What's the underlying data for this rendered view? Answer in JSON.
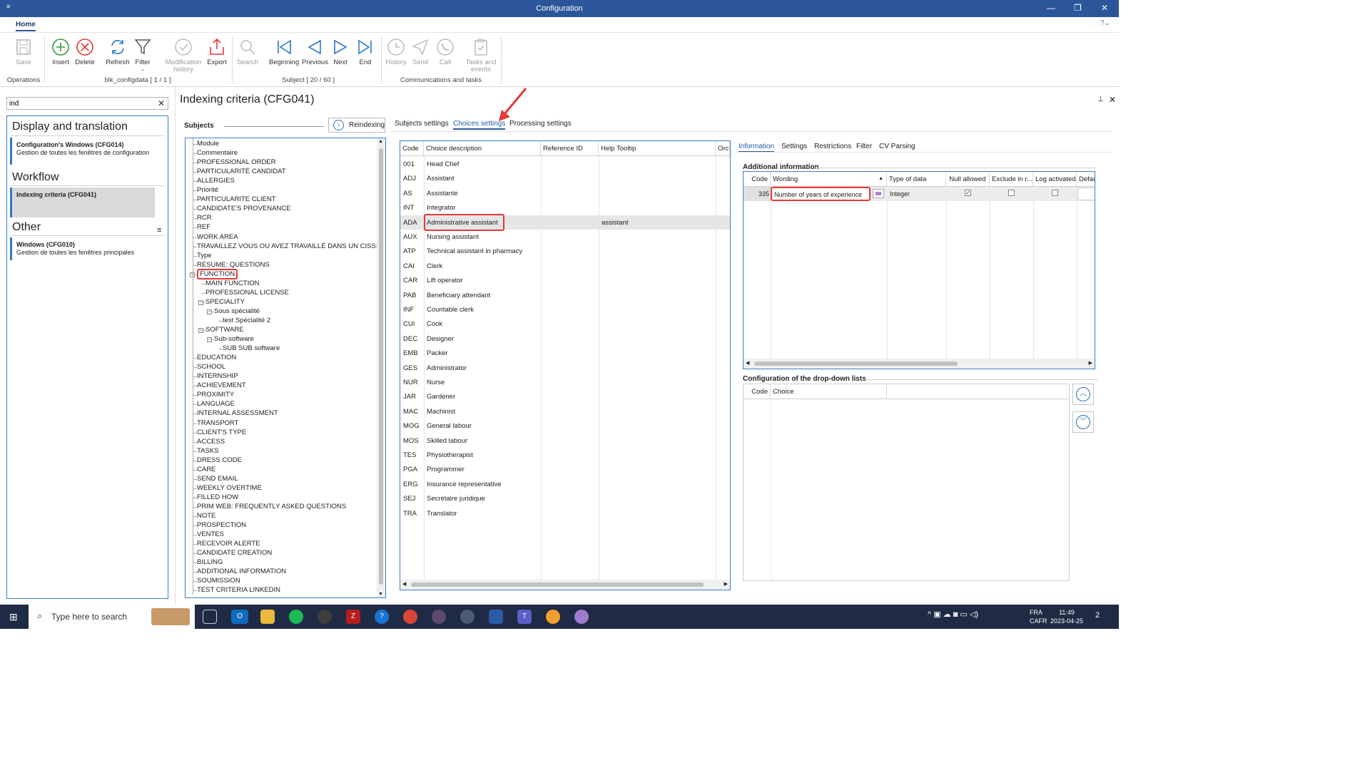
{
  "window": {
    "title": "Configuration",
    "menu_glyph": "≡",
    "minimize": "—",
    "restore": "❐",
    "close": "✕"
  },
  "ribbon": {
    "tab": "Home",
    "help": "?⌄",
    "buttons": {
      "save": "Save",
      "insert": "Insert",
      "delete": "Delete",
      "refresh": "Refresh",
      "filter": "Filter",
      "modification_history_1": "Modification",
      "modification_history_2": "history",
      "export": "Export",
      "search": "Search",
      "beginning": "Beginning",
      "previous": "Previous",
      "next": "Next",
      "end": "End",
      "history": "History",
      "send": "Send",
      "call": "Call",
      "tasks_events_1": "Tasks and",
      "tasks_events_2": "events"
    },
    "groups": {
      "operations": "Operations",
      "configdata": "blk_configdata [ 1 / 1 ]",
      "subject": "Subject [ 20 / 60 ]",
      "communications": "Communications and tasks"
    },
    "accent": "#2b579a"
  },
  "left": {
    "search_value": "ind",
    "clear": "✕",
    "menu_glyph": "≡",
    "sections": [
      {
        "title": "Display and translation",
        "items": [
          {
            "name": "Configuration's Windows (CFG014)",
            "desc": "Gestion de toutes les fenêtres de configuration"
          }
        ]
      },
      {
        "title": "Workflow",
        "items": [
          {
            "name": "Indexing criteria (CFG041)",
            "desc": ""
          }
        ]
      },
      {
        "title": "Other",
        "items": [
          {
            "name": "Windows (CFG010)",
            "desc": "Gestion de toutes les fenêtres principales"
          }
        ]
      }
    ]
  },
  "main": {
    "title": "Indexing criteria (CFG041)",
    "pin": "⊥",
    "close": "✕",
    "subjects_label": "Subjects",
    "reindex": "Reindexing",
    "reindex_glyph": "›",
    "tabs": [
      "Subjects settings",
      "Choices settings",
      "Processing settings"
    ],
    "active_tab": "Choices settings"
  },
  "tree": [
    {
      "label": "Module",
      "level": 0
    },
    {
      "label": "Commentaire",
      "level": 0
    },
    {
      "label": "PROFESSIONAL ORDER",
      "level": 0
    },
    {
      "label": "PARTICULARITÉ CANDIDAT",
      "level": 0
    },
    {
      "label": "ALLERGIES",
      "level": 0
    },
    {
      "label": "Priorité",
      "level": 0
    },
    {
      "label": "PARTICULARITE CLIENT",
      "level": 0
    },
    {
      "label": "CANDIDATE'S PROVENANCE",
      "level": 0
    },
    {
      "label": "RCR",
      "level": 0
    },
    {
      "label": "REF",
      "level": 0
    },
    {
      "label": "WORK AREA",
      "level": 0
    },
    {
      "label": "TRAVAILLEZ VOUS OU AVEZ TRAVAILLÉ DANS UN CISSS?",
      "level": 0
    },
    {
      "label": "Type",
      "level": 0
    },
    {
      "label": "RESUME: QUESTIONS",
      "level": 0
    },
    {
      "label": "FUNCTION",
      "level": 0,
      "expanded": true,
      "highlighted": true
    },
    {
      "label": "MAIN FUNCTION",
      "level": 1
    },
    {
      "label": "PROFESSIONAL LICENSE",
      "level": 1
    },
    {
      "label": "SPECIALITY",
      "level": 1,
      "expanded": true
    },
    {
      "label": "Sous spécialité",
      "level": 2,
      "expanded": true
    },
    {
      "label": "test Spécialité 2",
      "level": 3
    },
    {
      "label": "SOFTWARE",
      "level": 1,
      "expanded": true
    },
    {
      "label": "Sub-software",
      "level": 2,
      "expanded": true
    },
    {
      "label": "SUB SUB software",
      "level": 3
    },
    {
      "label": "EDUCATION",
      "level": 0
    },
    {
      "label": "SCHOOL",
      "level": 0
    },
    {
      "label": "INTERNSHIP",
      "level": 0
    },
    {
      "label": "ACHIEVEMENT",
      "level": 0
    },
    {
      "label": "PROXIMITY",
      "level": 0
    },
    {
      "label": "LANGUAGE",
      "level": 0
    },
    {
      "label": "INTERNAL ASSESSMENT",
      "level": 0
    },
    {
      "label": "TRANSPORT",
      "level": 0
    },
    {
      "label": "CLIENT'S TYPE",
      "level": 0
    },
    {
      "label": "ACCESS",
      "level": 0
    },
    {
      "label": "TASKS",
      "level": 0
    },
    {
      "label": "DRESS CODE",
      "level": 0
    },
    {
      "label": "CARE",
      "level": 0
    },
    {
      "label": "SEND EMAIL",
      "level": 0
    },
    {
      "label": "WEEKLY OVERTIME",
      "level": 0
    },
    {
      "label": "FILLED HOW",
      "level": 0
    },
    {
      "label": "PRIM WEB: FREQUENTLY ASKED QUESTIONS",
      "level": 0
    },
    {
      "label": "NOTE",
      "level": 0
    },
    {
      "label": "PROSPECTION",
      "level": 0
    },
    {
      "label": "VENTES",
      "level": 0
    },
    {
      "label": "RECEVOIR ALERTE",
      "level": 0
    },
    {
      "label": "CANDIDATE CREATION",
      "level": 0
    },
    {
      "label": "BILLING",
      "level": 0
    },
    {
      "label": "ADDITIONAL INFORMATION",
      "level": 0
    },
    {
      "label": "SOUMISSION",
      "level": 0
    },
    {
      "label": "TEST CRITERIA LINKEDIN",
      "level": 0
    }
  ],
  "choices": {
    "headers": [
      "Code",
      "Choice description",
      "Reference ID",
      "Help Tooltip",
      "Orc"
    ],
    "rows": [
      [
        "001",
        "Head Chef",
        "",
        ""
      ],
      [
        "ADJ",
        "Assistant",
        "",
        ""
      ],
      [
        "AS",
        "Assistante",
        "",
        ""
      ],
      [
        "INT",
        "Integrator",
        "",
        ""
      ],
      [
        "ADA",
        "Administrative assistant",
        "",
        "assistant"
      ],
      [
        "AUX",
        "Nursing assistant",
        "",
        ""
      ],
      [
        "ATP",
        "Technical assistant in pharmacy",
        "",
        ""
      ],
      [
        "CAI",
        "Clerk",
        "",
        ""
      ],
      [
        "CAR",
        "Lift operator",
        "",
        ""
      ],
      [
        "PAB",
        "Beneficiary attendant",
        "",
        ""
      ],
      [
        "INF",
        "Countable clerk",
        "",
        ""
      ],
      [
        "CUI",
        "Cook",
        "",
        ""
      ],
      [
        "DEC",
        "Designer",
        "",
        ""
      ],
      [
        "EMB",
        "Packer",
        "",
        ""
      ],
      [
        "GES",
        "Administrator",
        "",
        ""
      ],
      [
        "NUR",
        "Nurse",
        "",
        ""
      ],
      [
        "JAR",
        "Gardener",
        "",
        ""
      ],
      [
        "MAC",
        "Machinist",
        "",
        ""
      ],
      [
        "MOG",
        "General labour",
        "",
        ""
      ],
      [
        "MOS",
        "Skilled labour",
        "",
        ""
      ],
      [
        "TES",
        "Physiotherapist",
        "",
        ""
      ],
      [
        "PGA",
        "Programmer",
        "",
        ""
      ],
      [
        "ERG",
        "Insurance representative",
        "",
        ""
      ],
      [
        "SEJ",
        "Secrétaire juridique",
        "",
        ""
      ],
      [
        "TRA",
        "Translator",
        "",
        ""
      ]
    ],
    "selected_code": "ADA"
  },
  "right": {
    "tabs": [
      "Information",
      "Settings",
      "Restrictions",
      "Filter",
      "CV Parsing"
    ],
    "active_tab": "Information",
    "additional_info_label": "Additional information",
    "grid_headers": [
      "Code",
      "Wording",
      "Type of data",
      "Null allowed",
      "Exclude in r...",
      "Log activated",
      "Defau"
    ],
    "sort_glyph": "▲",
    "row": {
      "code": "335",
      "wording": "Number of years of experience",
      "type": "Integer",
      "null_allowed": true,
      "exclude": false,
      "log_activated": false
    },
    "ddl_label": "Configuration of the drop-down lists",
    "ddl_headers": [
      "Code",
      "Choice"
    ],
    "up_glyph": "︿",
    "down_glyph": "﹀"
  },
  "taskbar": {
    "search_placeholder": "Type here to search",
    "lang_1": "FRA",
    "lang_2": "CAFR",
    "time": "11:49",
    "date": "2023-04-25",
    "notifications": "2",
    "start_glyph": "⊞",
    "search_glyph": "⌕",
    "tray_glyphs": "^ ▣ ☁ ◙ ▭ ◁)"
  }
}
